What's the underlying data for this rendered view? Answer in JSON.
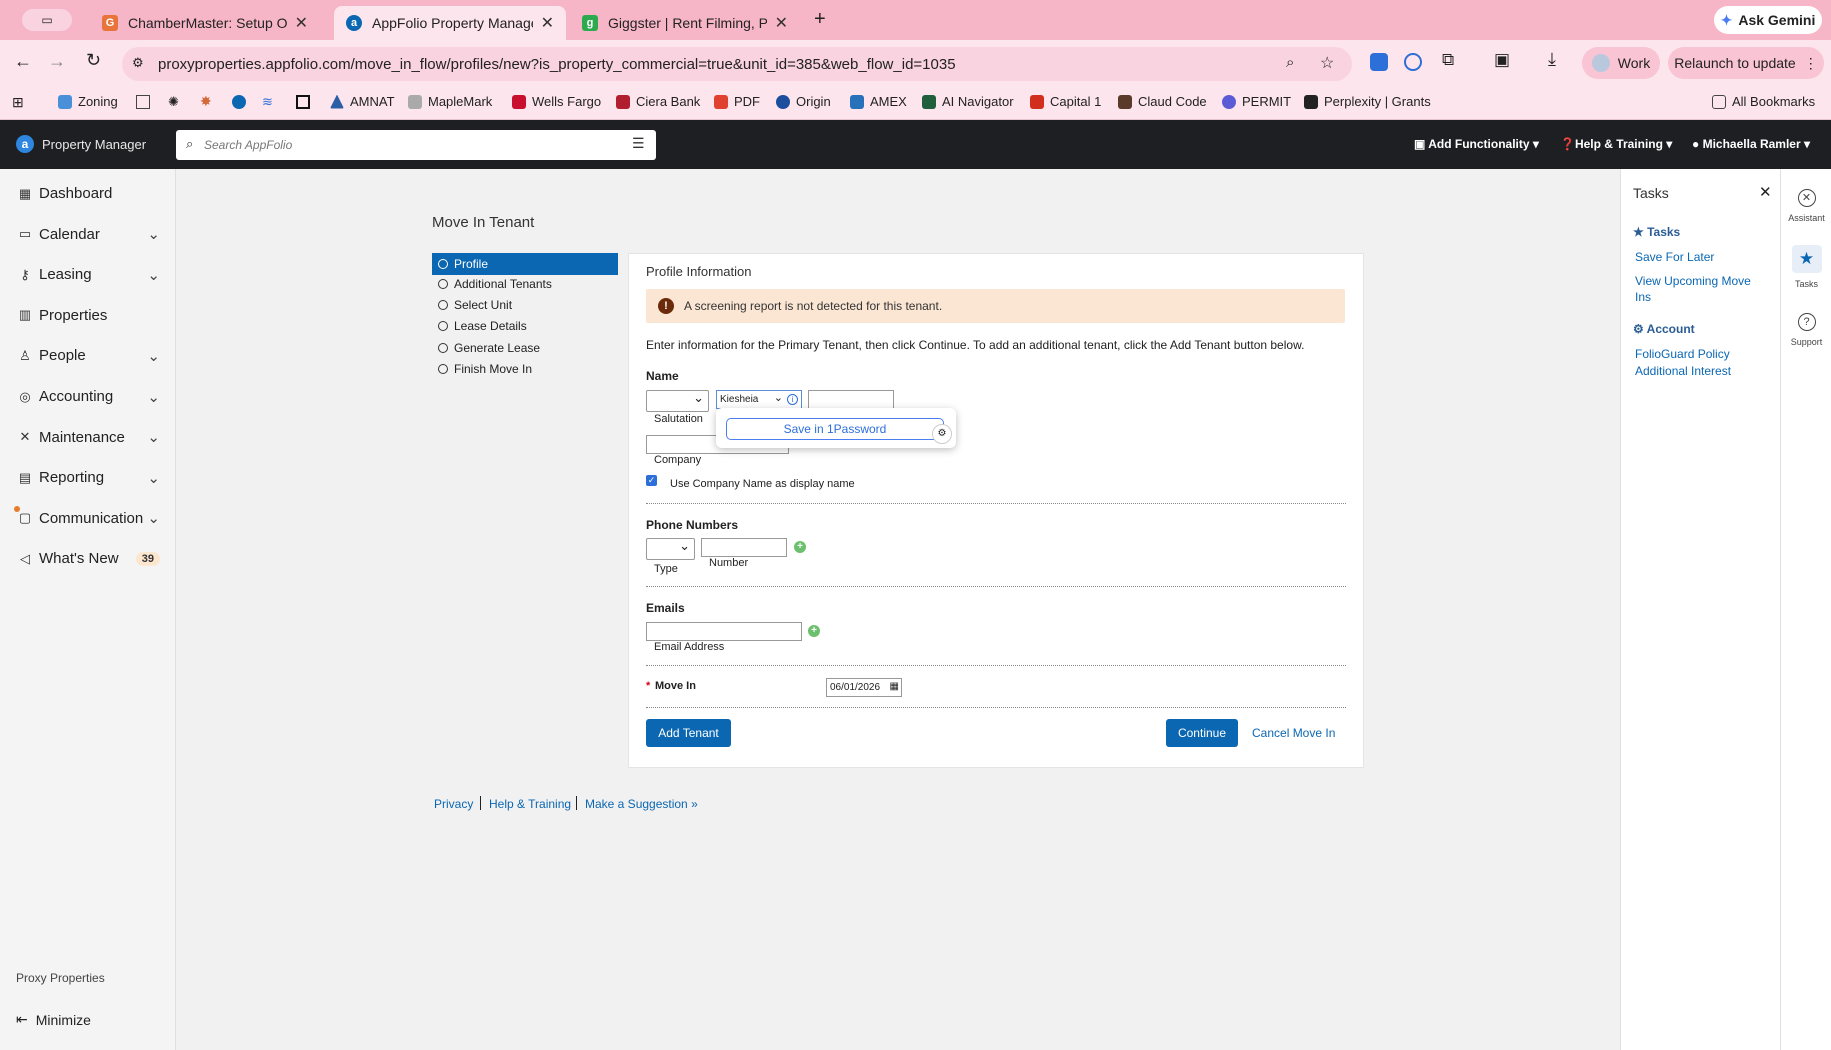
{
  "browser": {
    "tabs": [
      {
        "title": "ChamberMaster: Setup Optio",
        "color": "#e8743b",
        "glyph": "G"
      },
      {
        "title": "AppFolio Property Manager",
        "color": "#0b67b2",
        "glyph": "a"
      },
      {
        "title": "Giggster | Rent Filming, Photo",
        "color": "#2eaa4e",
        "glyph": "g"
      }
    ],
    "ask_gemini": "Ask Gemini",
    "url": "proxyproperties.appfolio.com/move_in_flow/profiles/new?is_property_commercial=true&unit_id=385&web_flow_id=1035",
    "work_label": "Work",
    "relaunch_label": "Relaunch to update",
    "bookmarks": [
      "Zoning",
      "AMNAT",
      "MapleMark",
      "Wells Fargo",
      "Ciera Bank",
      "PDF",
      "Origin",
      "AMEX",
      "AI Navigator",
      "Capital 1",
      "Claud Code",
      "PERMIT",
      "Perplexity | Grants"
    ],
    "all_bookmarks": "All Bookmarks"
  },
  "header": {
    "logo_text": "Property Manager",
    "search_placeholder": "Search AppFolio",
    "add_functionality": "Add Functionality",
    "help_training": "Help & Training",
    "user": "Michaella Ramler"
  },
  "sidebar": {
    "items": [
      {
        "label": "Dashboard",
        "icon": "dashboard-icon",
        "glyph": "▦",
        "chev": false
      },
      {
        "label": "Calendar",
        "icon": "calendar-icon",
        "glyph": "▭",
        "chev": true
      },
      {
        "label": "Leasing",
        "icon": "key-icon",
        "glyph": "⚷",
        "chev": true
      },
      {
        "label": "Properties",
        "icon": "building-icon",
        "glyph": "▥",
        "chev": false
      },
      {
        "label": "People",
        "icon": "person-icon",
        "glyph": "♙",
        "chev": true
      },
      {
        "label": "Accounting",
        "icon": "accounting-icon",
        "glyph": "◎",
        "chev": true
      },
      {
        "label": "Maintenance",
        "icon": "wrench-icon",
        "glyph": "✕",
        "chev": true
      },
      {
        "label": "Reporting",
        "icon": "table-icon",
        "glyph": "▤",
        "chev": true
      },
      {
        "label": "Communication",
        "icon": "chat-icon",
        "glyph": "▢",
        "chev": true
      },
      {
        "label": "What's New",
        "icon": "megaphone-icon",
        "glyph": "◁",
        "chev": false,
        "badge": "39"
      }
    ],
    "company": "Proxy Properties",
    "minimize": "Minimize"
  },
  "page": {
    "title": "Move In Tenant",
    "steps": [
      "Profile",
      "Additional Tenants",
      "Select Unit",
      "Lease Details",
      "Generate Lease",
      "Finish Move In"
    ],
    "section_title": "Profile Information",
    "warning": "A screening report is not detected for this tenant.",
    "instructions": "Enter information for the Primary Tenant, then click Continue. To add an additional tenant, click the Add Tenant button below.",
    "name_label": "Name",
    "first_name_value": "Kiesheia",
    "salutation_label": "Salutation",
    "save_1password": "Save in 1Password",
    "company_label": "Company",
    "use_company_label": "Use Company Name as display name",
    "use_company_checked": true,
    "phone_label": "Phone Numbers",
    "phone_type_label": "Type",
    "phone_number_label": "Number",
    "emails_label": "Emails",
    "email_address_label": "Email Address",
    "move_in_required": "*",
    "move_in_label": "Move In",
    "move_in_value": "06/01/2026",
    "add_tenant": "Add Tenant",
    "continue": "Continue",
    "cancel": "Cancel Move In"
  },
  "footer": {
    "privacy": "Privacy",
    "help": "Help & Training",
    "suggest": "Make a Suggestion »"
  },
  "tasks": {
    "title": "Tasks",
    "tasks_heading": "Tasks",
    "save_later": "Save For Later",
    "view_upcoming": "View Upcoming Move Ins",
    "account_heading": "Account",
    "foliogard": "FolioGuard Policy",
    "additional_interest": "Additional Interest"
  },
  "rail": {
    "assistant": "Assistant",
    "tasks": "Tasks",
    "support": "Support"
  },
  "colors": {
    "accent": "#0b67b2",
    "chrome": "#f7b6c8",
    "header": "#1d1f23",
    "warning_bg": "#fbe6d3"
  }
}
